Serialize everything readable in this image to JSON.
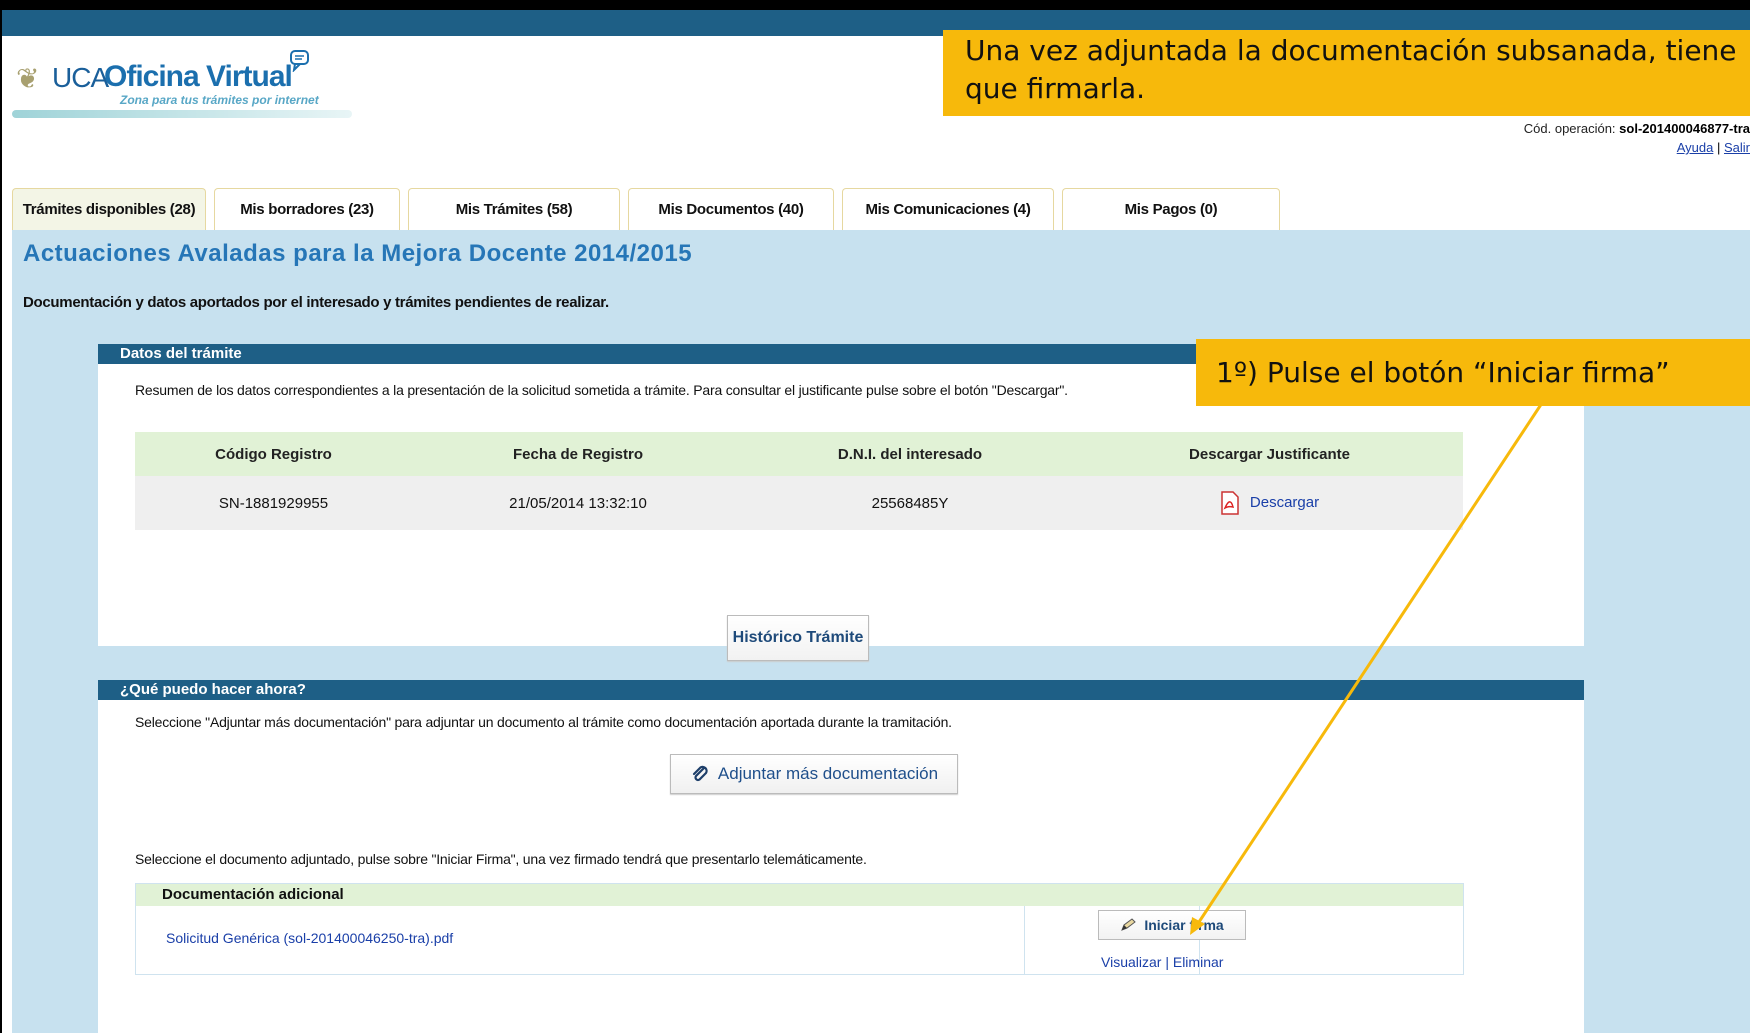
{
  "header": {
    "logo": {
      "prefix": "UCA",
      "name": "Oficina Virtual",
      "tagline": "Zona para tus trámites por internet"
    },
    "operation_label": "Cód. operación:",
    "operation_code": "sol-201400046877-tra",
    "help_link": "Ayuda",
    "separator": "|",
    "logout_link": "Salir"
  },
  "callouts": {
    "top": "Una vez adjuntada la documentación subsanada, tiene que firmarla.",
    "step1": "1º) Pulse el botón “Iniciar firma”"
  },
  "tabs": [
    {
      "label": "Trámites disponibles (28)"
    },
    {
      "label": "Mis borradores (23)"
    },
    {
      "label": "Mis Trámites (58)"
    },
    {
      "label": "Mis Documentos (40)"
    },
    {
      "label": "Mis Comunicaciones (4)"
    },
    {
      "label": "Mis Pagos (0)"
    }
  ],
  "page": {
    "title": "Actuaciones Avaladas para la Mejora Docente 2014/2015",
    "subtitle": "Documentación y datos aportados por el interesado y trámites pendientes de realizar."
  },
  "panel_tramite": {
    "heading": "Datos del trámite",
    "description": "Resumen de los datos correspondientes a la presentación de la solicitud sometida a trámite. Para consultar el justificante pulse sobre el botón \"Descargar\".",
    "columns": [
      "Código Registro",
      "Fecha de Registro",
      "D.N.I. del interesado",
      "Descargar Justificante"
    ],
    "row": {
      "codigo": "SN-1881929955",
      "fecha": "21/05/2014 13:32:10",
      "dni": "25568485Y",
      "download_label": "Descargar"
    },
    "history_button": "Histórico Trámite"
  },
  "panel_acciones": {
    "heading": "¿Qué puedo hacer ahora?",
    "instruction_attach": "Seleccione \"Adjuntar más documentación\" para adjuntar un documento al trámite como documentación aportada durante la tramitación.",
    "attach_button": "Adjuntar más documentación",
    "instruction_sign": "Seleccione el documento adjuntado, pulse sobre \"Iniciar Firma\", una vez firmado tendrá que presentarlo telemáticamente.",
    "doc_table_heading": "Documentación adicional",
    "document": "Solicitud Genérica (sol-201400046250-tra).pdf",
    "sign_button": "Iniciar firma",
    "view_link": "Visualizar",
    "action_separator": " | ",
    "delete_link": "Eliminar"
  },
  "colors": {
    "header_bar": "#1e5f86",
    "content_bg": "#c7e1ef",
    "callout": "#f7b90b",
    "title": "#2676b7",
    "table_header": "#e1f2d6"
  }
}
